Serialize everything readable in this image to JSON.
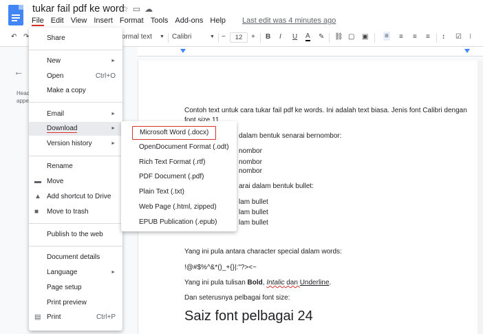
{
  "header": {
    "title": "tukar fail pdf ke word",
    "menus": [
      "File",
      "Edit",
      "View",
      "Insert",
      "Format",
      "Tools",
      "Add-ons",
      "Help"
    ],
    "last_edit": "Last edit was 4 minutes ago"
  },
  "toolbar": {
    "style": "ormal text",
    "font": "Calibri",
    "size": "12",
    "minus": "−",
    "plus": "+",
    "bold": "B",
    "italic": "I",
    "underline": "U",
    "text_color": "A"
  },
  "left_panel": {
    "hint_line1": "Head",
    "hint_line2": "appe"
  },
  "file_menu": {
    "share": "Share",
    "new": "New",
    "open": "Open",
    "open_shortcut": "Ctrl+O",
    "make_copy": "Make a copy",
    "email": "Email",
    "download": "Download",
    "version_history": "Version history",
    "rename": "Rename",
    "move": "Move",
    "add_shortcut": "Add shortcut to Drive",
    "move_trash": "Move to trash",
    "publish": "Publish to the web",
    "doc_details": "Document details",
    "language": "Language",
    "page_setup": "Page setup",
    "print_preview": "Print preview",
    "print": "Print",
    "print_shortcut": "Ctrl+P",
    "arrow": "►"
  },
  "download_menu": {
    "items": [
      "Microsoft Word (.docx)",
      "OpenDocument Format (.odt)",
      "Rich Text Format (.rtf)",
      "PDF Document (.pdf)",
      "Plain Text (.txt)",
      "Web Page (.html, zipped)",
      "EPUB Publication (.epub)"
    ]
  },
  "document": {
    "line1": "Contoh text untuk cara tukar fail pdf ke words. Ini adalah text biasa. Jenis font Calibri dengan",
    "line2": "font size 11",
    "line3": "dalam bentuk senarai bernombor:",
    "num1": "nombor",
    "num2": "nombor",
    "num3": "nombor",
    "line4": "arai dalam bentuk bullet:",
    "bul1": "lam bullet",
    "bul2": "lam bullet",
    "bul3": "lam bullet",
    "special_intro": "Yang ini pula antara character special dalam words:",
    "special_chars": "!@#$%^&*()_+{}|:\"?><~",
    "fmt_prefix": "Yang ini pula tulisan ",
    "fmt_bold": "Bold",
    "fmt_sep1": ", ",
    "fmt_italic": "Intalic",
    "fmt_sep2": " dan ",
    "fmt_underline": "Underline",
    "fmt_end": ".",
    "size_intro": "Dan seterusnya pelbagai font size:",
    "size_demo": "Saiz font pelbagai 24"
  },
  "colors": {
    "accent_red": "#d93025",
    "docs_blue": "#4285f4"
  }
}
